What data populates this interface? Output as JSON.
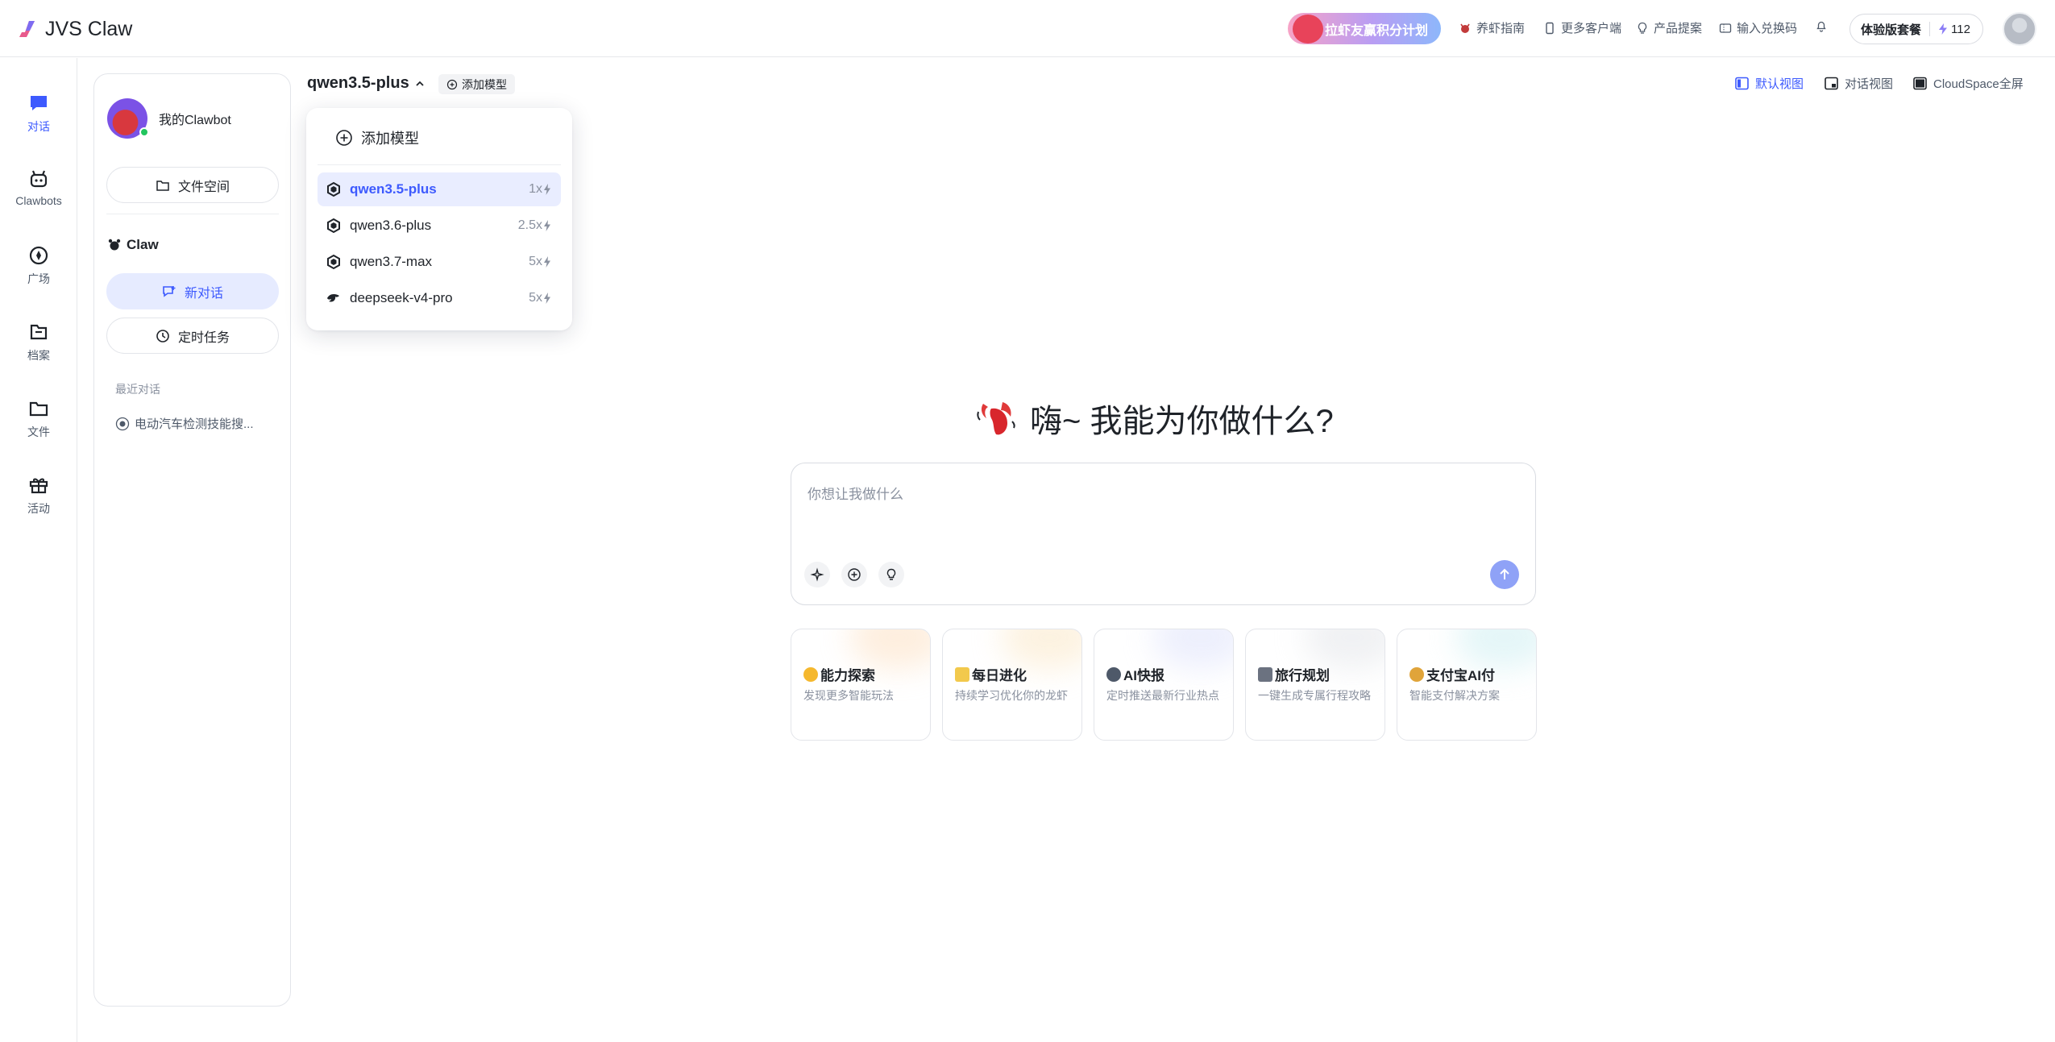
{
  "app": {
    "title": "JVS Claw"
  },
  "topbar": {
    "promo": "拉虾友赢积分计划",
    "links": [
      "养虾指南",
      "更多客户端",
      "产品提案",
      "输入兑换码"
    ],
    "plan_label": "体验版套餐",
    "credits": "112"
  },
  "rail": {
    "items": [
      {
        "label": "对话",
        "icon": "chat-icon"
      },
      {
        "label": "Clawbots",
        "icon": "robot-icon"
      },
      {
        "label": "广场",
        "icon": "compass-icon"
      },
      {
        "label": "档案",
        "icon": "archive-icon"
      },
      {
        "label": "文件",
        "icon": "folder-icon"
      },
      {
        "label": "活动",
        "icon": "gift-icon"
      }
    ]
  },
  "sidebar": {
    "bot_name": "我的Clawbot",
    "file_space": "文件空间",
    "section": "Claw",
    "new_chat": "新对话",
    "scheduled": "定时任务",
    "recent_title": "最近对话",
    "recent": [
      "电动汽车检测技能搜..."
    ]
  },
  "model_bar": {
    "selected": "qwen3.5-plus",
    "add_model": "添加模型",
    "views": [
      "默认视图",
      "对话视图",
      "CloudSpace全屏"
    ]
  },
  "dropdown": {
    "add_label": "添加模型",
    "models": [
      {
        "name": "qwen3.5-plus",
        "mult": "1x",
        "selected": true
      },
      {
        "name": "qwen3.6-plus",
        "mult": "2.5x"
      },
      {
        "name": "qwen3.7-max",
        "mult": "5x"
      },
      {
        "name": "deepseek-v4-pro",
        "mult": "5x"
      }
    ]
  },
  "main": {
    "greeting": "嗨~ 我能为你做什么?",
    "placeholder": "你想让我做什么",
    "cards": [
      {
        "title": "能力探索",
        "desc": "发现更多智能玩法",
        "color": "#fde1c4"
      },
      {
        "title": "每日进化",
        "desc": "持续学习优化你的龙虾",
        "color": "#fbe8c8"
      },
      {
        "title": "AI快报",
        "desc": "定时推送最新行业热点",
        "color": "#dfe3fb"
      },
      {
        "title": "旅行规划",
        "desc": "一键生成专属行程攻略",
        "color": "#e4e6ea"
      },
      {
        "title": "支付宝AI付",
        "desc": "智能支付解决方案",
        "color": "#cfeff2"
      }
    ]
  },
  "colors": {
    "accent": "#3d5afe",
    "accent_soft": "#e6ebff",
    "send": "#8fa2f7"
  }
}
